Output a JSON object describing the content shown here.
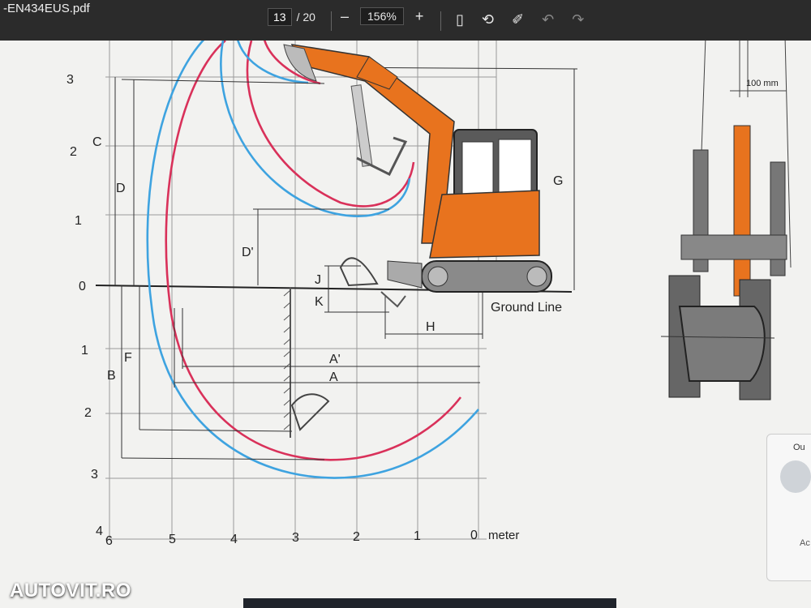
{
  "viewer": {
    "filename": "-EN434EUS.pdf",
    "current_page": "13",
    "total_pages": "/ 20",
    "zoom_level": "156%",
    "zoom_out": "–",
    "zoom_in": "+"
  },
  "diagram": {
    "y_ticks": [
      "3",
      "2",
      "1",
      "0",
      "1",
      "2",
      "3",
      "4"
    ],
    "x_ticks": [
      "6",
      "5",
      "4",
      "3",
      "2",
      "1",
      "0"
    ],
    "unit_label": "meter",
    "dims": {
      "C": "C",
      "D": "D",
      "D_prime": "D'",
      "B": "B",
      "F": "F",
      "G": "G",
      "J": "J",
      "K": "K",
      "H": "H",
      "A": "A",
      "A_prime": "A'"
    },
    "ground_label": "Ground Line",
    "blade_width": "100 mm"
  },
  "colors": {
    "boom_orange": "#e8731e",
    "curve_red": "#d9315a",
    "curve_blue": "#3ea3e0",
    "toolbar_bg": "#2b2b2b"
  },
  "overlay": {
    "panel_text": "Ou",
    "panel_text_2": "Ac",
    "brand": "AUTOVIT.RO"
  }
}
